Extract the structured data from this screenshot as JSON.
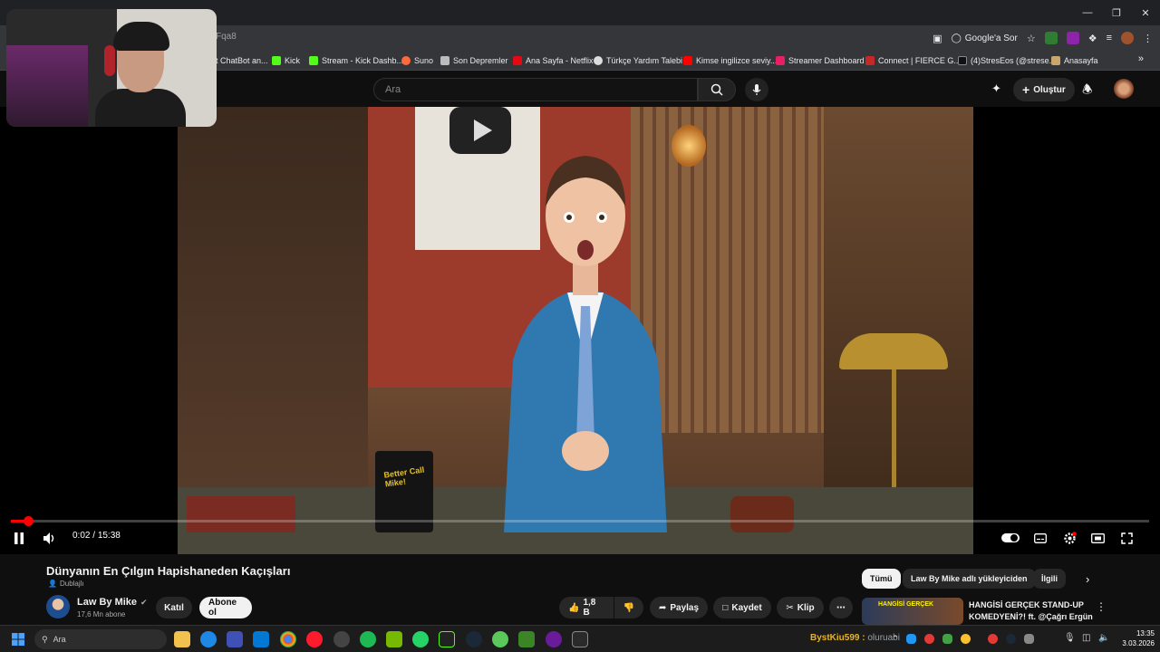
{
  "browser": {
    "url": "Fqa8",
    "ask_google": "Google'a Sor",
    "bookmarks": [
      "t ChatBot an...",
      "Kick",
      "Stream - Kick Dashb...",
      "Suno",
      "Son Depremler",
      "Ana Sayfa - Netflix",
      "Türkçe Yardım Talebi",
      "Kimse ingilizce seviy...",
      "Streamer Dashboard",
      "Connect | FIERCE G...",
      "(4)StresEos (@strese...",
      "Anasayfa"
    ],
    "bookmarks_more": "»"
  },
  "youtube": {
    "search_placeholder": "Ara",
    "create_label": "Oluştur"
  },
  "player": {
    "current_time": "0:02",
    "duration": "15:38",
    "progress_fraction": 0.002
  },
  "thumbnail_scene": {
    "mug_text": "Better Call Mike!"
  },
  "video": {
    "title": "Dünyanın En Çılgın Hapishaneden Kaçışları",
    "dub_label": "Dublajlı",
    "channel_name": "Law By Mike",
    "subscribers": "17,6 Mn abone",
    "join_label": "Katıl",
    "subscribe_label": "Abone ol",
    "likes": "1,8 B",
    "share_label": "Paylaş",
    "save_label": "Kaydet",
    "clip_label": "Klip"
  },
  "recommendations": {
    "chips": [
      "Tümü",
      "Law By Mike adlı yükleyiciden",
      "İlgili"
    ],
    "first": {
      "thumb_text": "HANGİSİ GERÇEK",
      "title": "HANGİSİ GERÇEK STAND-UP KOMEDYENİ?! ft. @Çağrı Ergün"
    }
  },
  "taskbar": {
    "search_placeholder": "Ara",
    "tray_streamer": "BystKiu599",
    "tray_status": "oluruabi",
    "time": "13:35",
    "date": "3.03.2026"
  }
}
